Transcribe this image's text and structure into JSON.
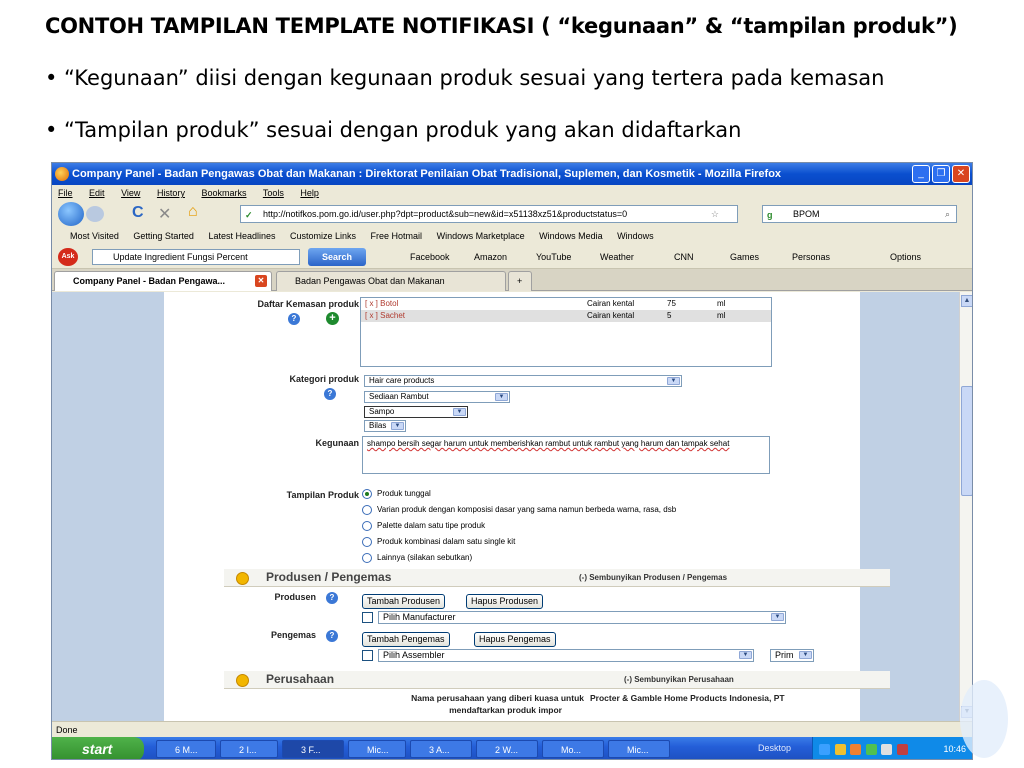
{
  "slide": {
    "title": "CONTOH TAMPILAN TEMPLATE NOTIFIKASI ( “kegunaan” & “tampilan produk”)",
    "bullets": [
      "• “Kegunaan” diisi dengan kegunaan produk sesuai yang tertera pada kemasan",
      "• “Tampilan produk” sesuai dengan produk yang akan didaftarkan"
    ]
  },
  "browser": {
    "window_title": "Company Panel - Badan Pengawas Obat dan Makanan : Direktorat Penilaian Obat Tradisional, Suplemen, dan Kosmetik - Mozilla Firefox",
    "menu": [
      "File",
      "Edit",
      "View",
      "History",
      "Bookmarks",
      "Tools",
      "Help"
    ],
    "url": "http://notifkos.pom.go.id/user.php?dpt=product&sub=new&id=x51138xz51&productstatus=0",
    "search_value": "BPOM",
    "bookmarks": [
      "Most Visited",
      "Getting Started",
      "Latest Headlines",
      "Customize Links",
      "Free Hotmail",
      "Windows Marketplace",
      "Windows Media",
      "Windows"
    ],
    "ask_toolbar": {
      "search_value": "Update Ingredient Fungsi  Percent",
      "search_label": "Search",
      "items": [
        "Facebook",
        "Amazon",
        "YouTube",
        "Weather",
        "CNN",
        "Games",
        "Personas"
      ],
      "options_label": "Options"
    },
    "tabs": [
      "Company Panel - Badan Pengawa...",
      "Badan Pengawas Obat dan Makanan"
    ],
    "status": "Done"
  },
  "form": {
    "kemasan": {
      "label": "Daftar Kemasan produk",
      "rows": [
        {
          "name": "[ x ] Botol",
          "form": "Cairan kental",
          "qty": "75",
          "unit": "ml"
        },
        {
          "name": "[ x ] Sachet",
          "form": "Cairan kental",
          "qty": "5",
          "unit": "ml"
        }
      ]
    },
    "kategori": {
      "label": "Kategori produk",
      "selects": [
        "Hair care products",
        "Sediaan Rambut",
        "Sampo",
        "Bilas"
      ]
    },
    "kegunaan": {
      "label": "Kegunaan",
      "value": "shampo bersih segar harum untuk memberishkan rambut untuk rambut yang harum dan tampak sehat"
    },
    "tampilan": {
      "label": "Tampilan Produk",
      "options": [
        "Produk tunggal",
        "Varian produk dengan komposisi dasar yang sama namun berbeda warna, rasa, dsb",
        "Palette dalam satu tipe produk",
        "Produk kombinasi dalam satu single kit",
        "Lainnya (silakan sebutkan)"
      ]
    },
    "produsen_section": {
      "title": "Produsen / Pengemas",
      "toggle": "(-) Sembunyikan Produsen / Pengemas",
      "produsen_label": "Produsen",
      "add_produsen": "Tambah Produsen",
      "del_produsen": "Hapus Produsen",
      "manufacturer_select": "Pilih Manufacturer",
      "pengemas_label": "Pengemas",
      "add_pengemas": "Tambah Pengemas",
      "del_pengemas": "Hapus Pengemas",
      "assembler_select": "Pilih Assembler",
      "prim_select": "Prim"
    },
    "perusahaan_section": {
      "title": "Perusahaan",
      "toggle": "(-) Sembunyikan Perusahaan",
      "name_label_1": "Nama perusahaan yang diberi kuasa untuk",
      "name_label_2": "mendaftarkan produk impor",
      "name_value": "Procter & Gamble Home Products Indonesia, PT"
    }
  },
  "taskbar": {
    "start": "start",
    "items": [
      "6 M...",
      "2 I...",
      "3 F...",
      "Mic...",
      "3 A...",
      "2 W...",
      "Mo...",
      "Mic..."
    ],
    "desktop": "Desktop",
    "time": "10:46"
  }
}
